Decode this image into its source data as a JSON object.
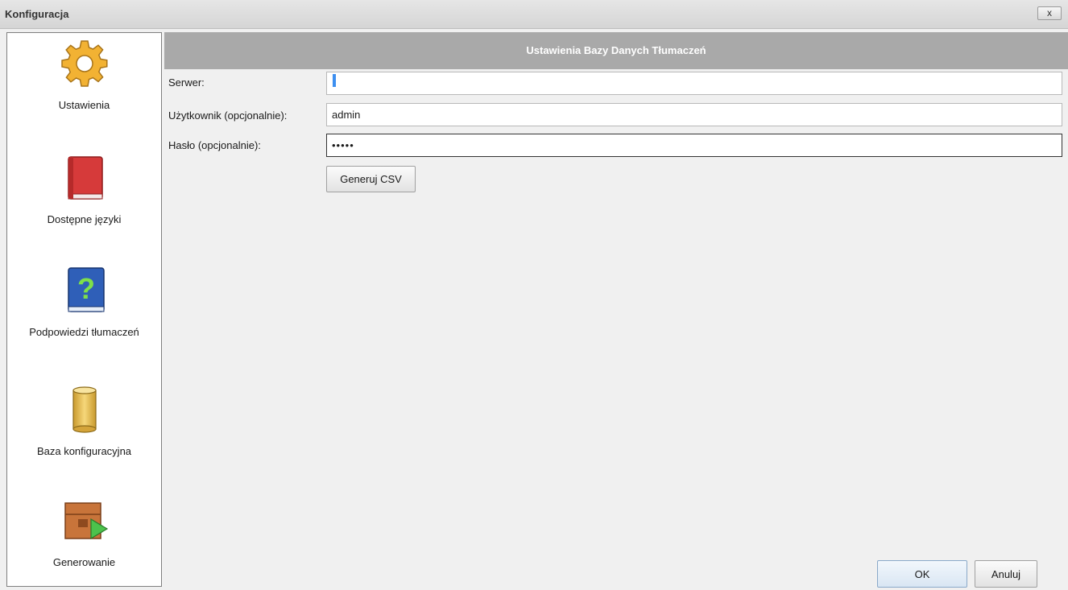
{
  "window": {
    "title": "Konfiguracja",
    "close_label": "x"
  },
  "sidebar": {
    "items": [
      {
        "label": "Ustawienia",
        "icon": "gear-icon"
      },
      {
        "label": "Dostępne języki",
        "icon": "red-book-icon"
      },
      {
        "label": "Podpowiedzi tłumaczeń",
        "icon": "help-book-icon"
      },
      {
        "label": "Baza konfiguracyjna",
        "icon": "database-icon"
      },
      {
        "label": "Generowanie",
        "icon": "box-export-icon"
      }
    ]
  },
  "main": {
    "header": "Ustawienia Bazy Danych Tłumaczeń",
    "fields": [
      {
        "label": "Serwer:",
        "value": "."
      },
      {
        "label": "Użytkownik (opcjonalnie):",
        "value": "admin"
      },
      {
        "label": "Hasło (opcjonalnie):",
        "value": "•••••"
      }
    ],
    "generate_csv_label": "Generuj CSV"
  },
  "footer": {
    "ok_label": "OK",
    "cancel_label": "Anuluj"
  },
  "colors": {
    "header_bg": "#a9a9a9",
    "selection": "#3d8ff0",
    "gear": "#f2b233",
    "red_book": "#d63a3a",
    "blue_book": "#2f5fb8",
    "cylinder": "#e8c35a",
    "box": "#c8743a",
    "play": "#4cc24c"
  }
}
